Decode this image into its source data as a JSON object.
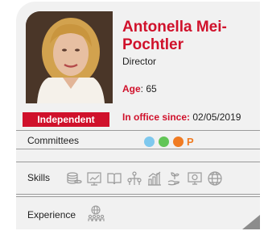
{
  "profile": {
    "name": "Antonella Mei-Pochtler",
    "role": "Director",
    "age_label": "Age",
    "age_value": ": 65",
    "in_office_label": "In office since:",
    "in_office_value": " 02/05/2019",
    "status_badge": "Independent"
  },
  "committees": {
    "label": "Committees",
    "dots": [
      {
        "icon": "committee-dot-blue",
        "color": "#7ec8ee"
      },
      {
        "icon": "committee-dot-green",
        "color": "#62c557"
      },
      {
        "icon": "committee-dot-orange",
        "color": "#f07b22"
      }
    ],
    "marker": "P",
    "marker_color": "#f07b22"
  },
  "skills": {
    "label": "Skills",
    "icons": [
      "coins-icon",
      "chart-board-icon",
      "book-icon",
      "people-network-icon",
      "bar-chart-icon",
      "plant-hand-icon",
      "monitor-icon",
      "globe-icon"
    ]
  },
  "experience": {
    "label": "Experience",
    "icon": "globe-people-icon"
  },
  "colors": {
    "accent": "#d0112b",
    "card_background": "#f1f1f1"
  }
}
